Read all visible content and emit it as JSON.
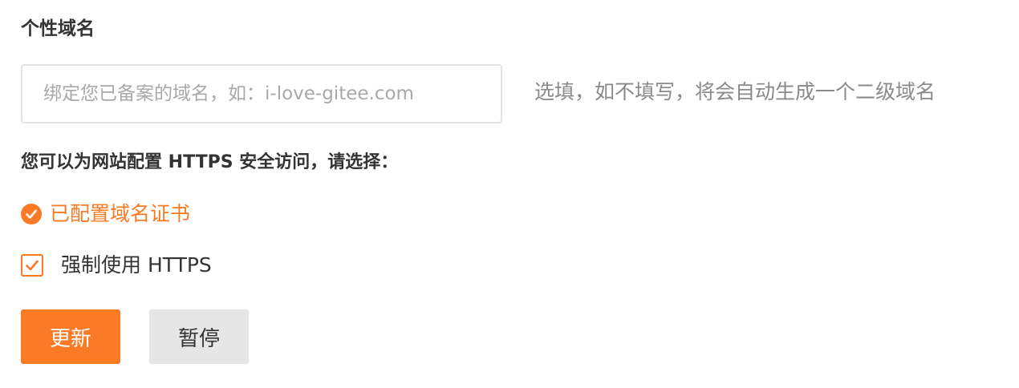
{
  "section": {
    "title": "个性域名"
  },
  "domain_input": {
    "value": "",
    "placeholder": "绑定您已备案的域名，如：i-love-gitee.com",
    "hint": "选填，如不填写，将会自动生成一个二级域名"
  },
  "https": {
    "prompt": "您可以为网站配置 HTTPS 安全访问，请选择：",
    "cert_status": "已配置域名证书",
    "cert_icon": "check-circle-icon",
    "force_label": "强制使用 HTTPS",
    "force_checked": true
  },
  "actions": {
    "update_label": "更新",
    "pause_label": "暂停"
  },
  "colors": {
    "accent": "#fa7a26",
    "secondary_button": "#e6e6e6",
    "hint_text": "#8a8a8a"
  }
}
